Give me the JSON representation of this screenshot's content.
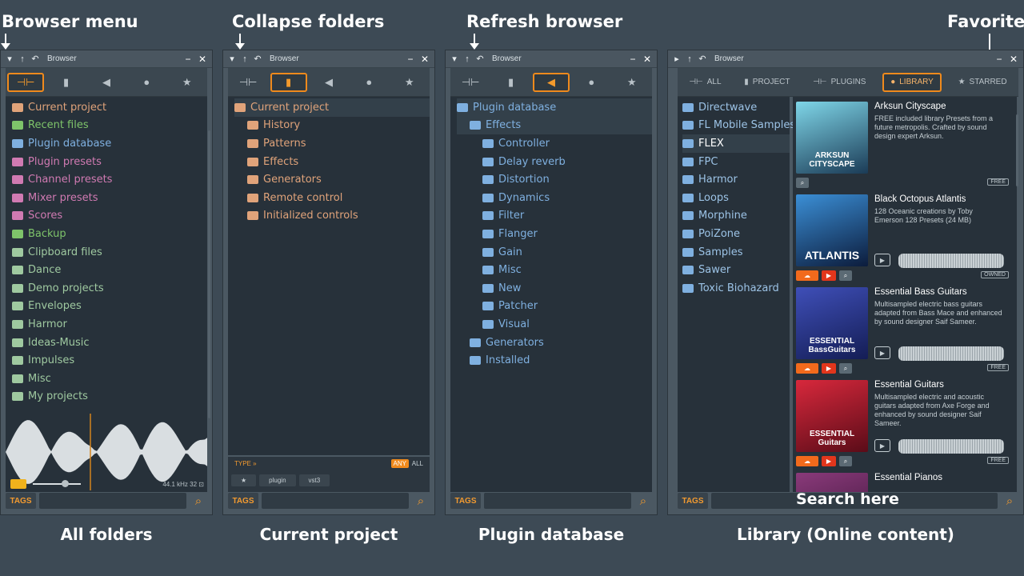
{
  "annotations": {
    "browser_menu": "Browser menu",
    "collapse_folders": "Collapse folders",
    "refresh_browser": "Refresh browser",
    "favorites": "Favorites",
    "search_here": "Search here"
  },
  "captions": [
    "All folders",
    "Current project",
    "Plugin database",
    "Library (Online content)"
  ],
  "window": {
    "title": "Browser"
  },
  "footer": {
    "tags_label": "TAGS"
  },
  "panel1": {
    "items": [
      {
        "label": "Current project",
        "color": "#e0a37a"
      },
      {
        "label": "Recent files",
        "color": "#7ec46a"
      },
      {
        "label": "Plugin database",
        "color": "#7fb0e0"
      },
      {
        "label": "Plugin presets",
        "color": "#d07ab2"
      },
      {
        "label": "Channel presets",
        "color": "#d07ab2"
      },
      {
        "label": "Mixer presets",
        "color": "#d07ab2"
      },
      {
        "label": "Scores",
        "color": "#d07ab2"
      },
      {
        "label": "Backup",
        "color": "#7ec46a"
      },
      {
        "label": "Clipboard files",
        "color": "#9fc9a0"
      },
      {
        "label": "Dance",
        "color": "#9fc9a0"
      },
      {
        "label": "Demo projects",
        "color": "#9fc9a0"
      },
      {
        "label": "Envelopes",
        "color": "#9fc9a0"
      },
      {
        "label": "Harmor",
        "color": "#9fc9a0"
      },
      {
        "label": "Ideas-Music",
        "color": "#9fc9a0"
      },
      {
        "label": "Impulses",
        "color": "#9fc9a0"
      },
      {
        "label": "Misc",
        "color": "#9fc9a0"
      },
      {
        "label": "My projects",
        "color": "#9fc9a0"
      }
    ],
    "sample_rate": "44.1",
    "sample_rate_unit": "kHz",
    "bit_depth": "32",
    "volume_level": 0.6
  },
  "panel2": {
    "items": [
      {
        "label": "Current project",
        "color": "#e0a37a",
        "indent": 0
      },
      {
        "label": "History",
        "color": "#e0a37a",
        "indent": 1
      },
      {
        "label": "Patterns",
        "color": "#e0a37a",
        "indent": 1
      },
      {
        "label": "Effects",
        "color": "#e0a37a",
        "indent": 1
      },
      {
        "label": "Generators",
        "color": "#e0a37a",
        "indent": 1
      },
      {
        "label": "Remote control",
        "color": "#e0a37a",
        "indent": 1
      },
      {
        "label": "Initialized controls",
        "color": "#e0a37a",
        "indent": 1
      }
    ],
    "type_label": "TYPE »",
    "any_label": "ANY",
    "all_label": "ALL",
    "filter_buttons": [
      "★",
      "plugin",
      "vst3"
    ]
  },
  "panel3": {
    "items": [
      {
        "label": "Plugin database",
        "color": "#7fb0e0",
        "indent": 0
      },
      {
        "label": "Effects",
        "color": "#7fb0e0",
        "indent": 1
      },
      {
        "label": "Controller",
        "color": "#7fb0e0",
        "indent": 2
      },
      {
        "label": "Delay reverb",
        "color": "#7fb0e0",
        "indent": 2
      },
      {
        "label": "Distortion",
        "color": "#7fb0e0",
        "indent": 2
      },
      {
        "label": "Dynamics",
        "color": "#7fb0e0",
        "indent": 2
      },
      {
        "label": "Filter",
        "color": "#7fb0e0",
        "indent": 2
      },
      {
        "label": "Flanger",
        "color": "#7fb0e0",
        "indent": 2
      },
      {
        "label": "Gain",
        "color": "#7fb0e0",
        "indent": 2
      },
      {
        "label": "Misc",
        "color": "#7fb0e0",
        "indent": 2
      },
      {
        "label": "New",
        "color": "#7fb0e0",
        "indent": 2
      },
      {
        "label": "Patcher",
        "color": "#7fb0e0",
        "indent": 2
      },
      {
        "label": "Visual",
        "color": "#7fb0e0",
        "indent": 2
      },
      {
        "label": "Generators",
        "color": "#7fb0e0",
        "indent": 1
      },
      {
        "label": "Installed",
        "color": "#7fb0e0",
        "indent": 1
      }
    ]
  },
  "panel4": {
    "tabs": [
      {
        "label": "ALL",
        "icon": "plug-icon"
      },
      {
        "label": "PROJECT",
        "icon": "file-icon"
      },
      {
        "label": "PLUGINS",
        "icon": "plug-icon"
      },
      {
        "label": "LIBRARY",
        "icon": "globe-icon"
      },
      {
        "label": "STARRED",
        "icon": "star-icon"
      }
    ],
    "categories": [
      "Directwave",
      "FL Mobile Samples",
      "FLEX",
      "FPC",
      "Harmor",
      "Loops",
      "Morphine",
      "PoiZone",
      "Samples",
      "Sawer",
      "Toxic Biohazard"
    ],
    "selected_category": "FLEX",
    "products": [
      {
        "name": "Arksun Cityscape",
        "desc": "FREE included library Presets from a future metropolis. Crafted by sound design expert Arksun.",
        "thumb_title": "ARKSUN CITYSCAPE",
        "badge": "FREE",
        "colors": [
          "#7fd6e8",
          "#1b3b56"
        ]
      },
      {
        "name": "Black Octopus Atlantis",
        "desc": "128 Oceanic creations by Toby Emerson 128 Presets (24 MB)",
        "thumb_title": "ATLANTIS",
        "badge": "OWNED",
        "colors": [
          "#3b8fd6",
          "#0c1c3c"
        ]
      },
      {
        "name": "Essential Bass Guitars",
        "desc": "Multisampled electric bass guitars adapted from Bass Mace and enhanced by sound designer Saif Sameer.",
        "thumb_title": "ESSENTIAL BassGuitars",
        "badge": "FREE",
        "colors": [
          "#3f4fb8",
          "#141d55"
        ]
      },
      {
        "name": "Essential Guitars",
        "desc": "Multisampled electric and acoustic guitars adapted from Axe Forge and enhanced by sound designer Saif Sameer.",
        "thumb_title": "ESSENTIAL Guitars",
        "badge": "FREE",
        "colors": [
          "#d8283c",
          "#5a0c18"
        ]
      },
      {
        "name": "Essential Pianos",
        "desc": "",
        "thumb_title": "",
        "badge": "",
        "colors": [
          "#8a3a7a",
          "#3a1438"
        ]
      }
    ]
  },
  "colors": {
    "accent": "#f08a1c"
  }
}
